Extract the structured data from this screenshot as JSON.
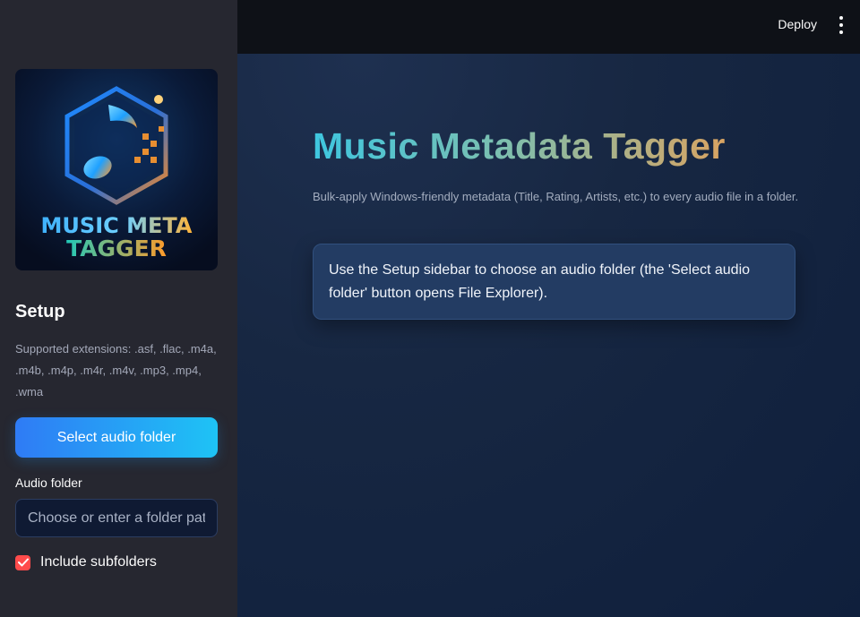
{
  "topbar": {
    "deploy_label": "Deploy",
    "menu_icon": "more-vertical-icon"
  },
  "sidebar": {
    "logo": {
      "line1": "MUSIC META",
      "line2": "TAGGER",
      "icon": "music-note-icon"
    },
    "setup_title": "Setup",
    "extensions_text": "Supported extensions: .asf, .flac, .m4a, .m4b, .m4p, .m4r, .m4v, .mp3, .mp4, .wma",
    "select_button_label": "Select audio folder",
    "folder_label": "Audio folder",
    "folder_placeholder": "Choose or enter a folder path",
    "folder_value": "",
    "subfolders_label": "Include subfolders",
    "subfolders_checked": true
  },
  "main": {
    "title": "Music Metadata Tagger",
    "subtitle": "Bulk-apply Windows-friendly metadata (Title, Rating, Artists, etc.) to every audio file in a folder.",
    "info_message": "Use the Setup sidebar to choose an audio folder (the 'Select audio folder' button opens File Explorer)."
  },
  "colors": {
    "sidebar_bg": "#262730",
    "main_bg": "#172742",
    "accent_button_start": "#2f7bf5",
    "accent_button_end": "#1ec3f5",
    "checkbox": "#ff4b4b",
    "info_box_bg": "#233c63"
  }
}
